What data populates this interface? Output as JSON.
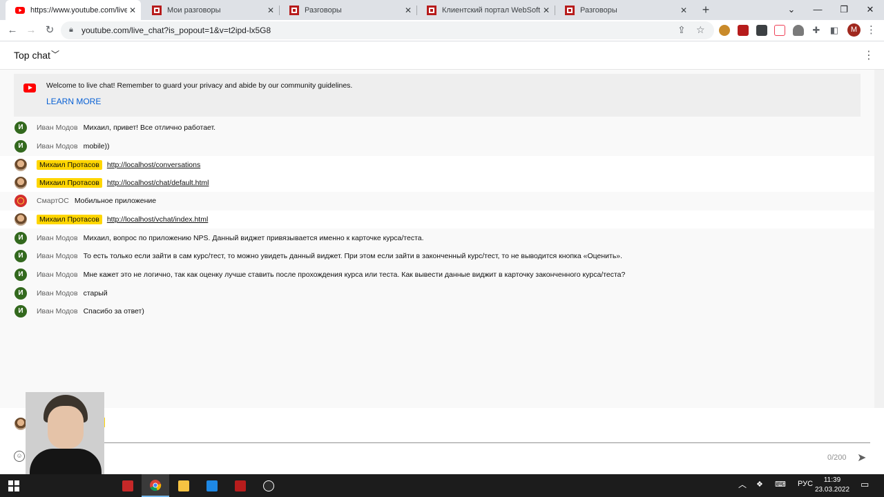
{
  "browser": {
    "tabs": [
      {
        "title": "https://www.youtube.com/live_ch",
        "active": true,
        "favicon": "youtube-icon"
      },
      {
        "title": "Мои разговоры",
        "active": false,
        "favicon": "websoft-icon"
      },
      {
        "title": "Разговоры",
        "active": false,
        "favicon": "websoft-icon"
      },
      {
        "title": "Клиентский портал WebSoft",
        "active": false,
        "favicon": "websoft-icon"
      },
      {
        "title": "Разговоры",
        "active": false,
        "favicon": "websoft-icon"
      }
    ],
    "url": "youtube.com/live_chat?is_popout=1&v=t2ipd-lx5G8",
    "profile_initial": "M"
  },
  "chat": {
    "mode_label": "Top chat",
    "welcome": {
      "message": "Welcome to live chat! Remember to guard your privacy and abide by our community guidelines.",
      "learn_more": "LEARN MORE"
    },
    "messages": [
      {
        "author": "Иван Модов",
        "text": "Михаил, привет! Все отлично работает.",
        "avatar": "И",
        "owner": false
      },
      {
        "author": "Иван Модов",
        "text": "mobile))",
        "avatar": "И",
        "owner": false
      },
      {
        "author": "Михаил Протасов",
        "text": "http://localhost/conversations",
        "avatar": "",
        "owner": true
      },
      {
        "author": "Михаил Протасов",
        "text": "http://localhost/chat/default.html",
        "avatar": "",
        "owner": true
      },
      {
        "author": "СмартОС",
        "text": "Мобильное приложение",
        "avatar": "",
        "owner": false
      },
      {
        "author": "Михаил Протасов",
        "text": "http://localhost/vchat/index.html",
        "avatar": "",
        "owner": true
      },
      {
        "author": "Иван Модов",
        "text": "Михаил, вопрос по приложению NPS. Данный виджет привязывается именно к карточке курса/теста.",
        "avatar": "И",
        "owner": false
      },
      {
        "author": "Иван Модов",
        "text": "То есть только если зайти в сам курс/тест, то можно увидеть данный виджет. При этом если зайти в законченный курс/тест, то не выводится кнопка «Оценить».",
        "avatar": "И",
        "owner": false
      },
      {
        "author": "Иван Модов",
        "text": "Мне кажет это не логично, так как оценку лучше ставить после прохождения курса или теста. Как вывести данные виджит в карточку законченного курса/теста?",
        "avatar": "И",
        "owner": false
      },
      {
        "author": "Иван Модов",
        "text": "старый",
        "avatar": "И",
        "owner": false
      },
      {
        "author": "Иван Модов",
        "text": "Спасибо за ответ)",
        "avatar": "И",
        "owner": false
      }
    ],
    "input": {
      "counter": "0/200"
    }
  },
  "taskbar": {
    "language": "РУС",
    "time": "11:39",
    "date": "23.03.2022"
  },
  "colors": {
    "youtube_red": "#ff0000",
    "owner_badge": "#ffd600",
    "link_blue": "#065fd4",
    "avatar_green": "#33691e"
  }
}
